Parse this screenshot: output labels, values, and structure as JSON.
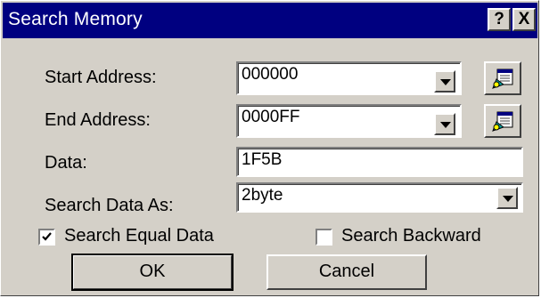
{
  "window": {
    "title": "Search Memory",
    "help_label": "?",
    "close_label": "X"
  },
  "form": {
    "start_address": {
      "label": "Start Address:",
      "value": "000000"
    },
    "end_address": {
      "label": "End Address:",
      "value": "0000FF"
    },
    "data": {
      "label": "Data:",
      "value": "1F5B"
    },
    "search_as": {
      "label": "Search Data As:",
      "value": "2byte"
    }
  },
  "options": {
    "equal": {
      "label": "Search Equal Data",
      "checked": true
    },
    "backward": {
      "label": "Search Backward",
      "checked": false
    }
  },
  "buttons": {
    "ok": "OK",
    "cancel": "Cancel"
  },
  "colors": {
    "title_bar": "#000080",
    "face": "#d4d0c8"
  }
}
